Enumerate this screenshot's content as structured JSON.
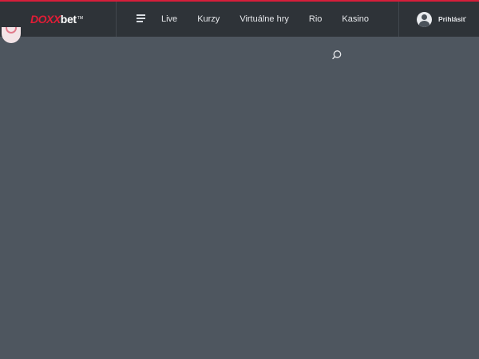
{
  "brand": {
    "part1": "DOXX",
    "part2": "bet",
    "tm": "TM",
    "accent": "#e11d36"
  },
  "nav": {
    "menu_icon": "hamburger-menu-icon",
    "items": [
      {
        "label": "Live"
      },
      {
        "label": "Kurzy"
      },
      {
        "label": "Virtuálne hry"
      },
      {
        "label": "Rio"
      },
      {
        "label": "Kasino"
      }
    ]
  },
  "account": {
    "avatar_icon": "user-avatar-icon",
    "login_label": "Prihlásiť"
  },
  "search": {
    "icon": "search-icon"
  },
  "colors": {
    "topbar": "#2e3338",
    "background": "#4e565f",
    "accent_border": "#d61e3a"
  }
}
